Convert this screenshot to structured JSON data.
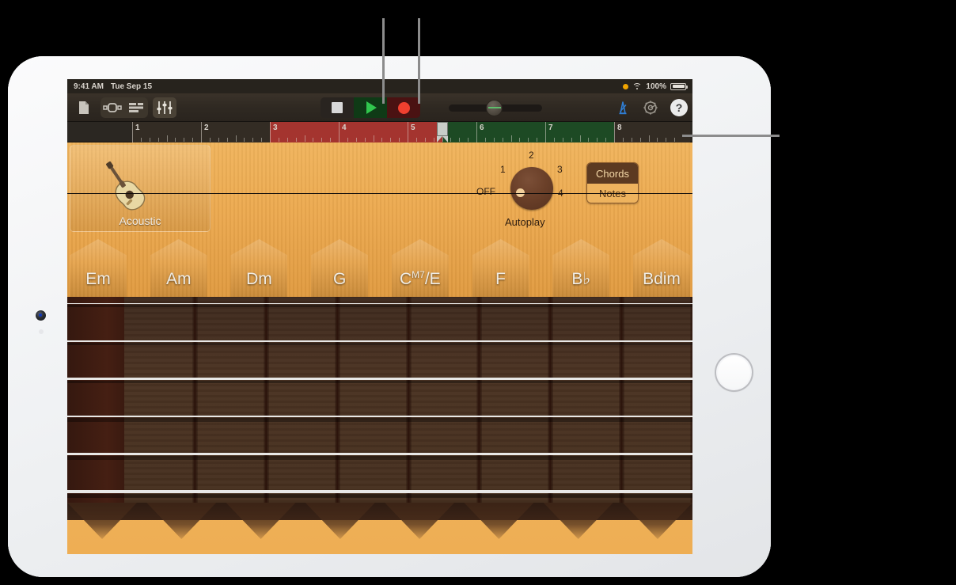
{
  "device": {
    "name": "ipad"
  },
  "status_bar": {
    "time": "9:41 AM",
    "date": "Tue Sep 15",
    "battery_percent": "100%",
    "recording_indicator": "orange-dot",
    "wifi_icon": "wifi-icon",
    "battery_icon": "battery-icon"
  },
  "toolbar": {
    "left_buttons": [
      {
        "name": "document-icon",
        "label": "Document"
      },
      {
        "name": "instrument-browser-icon",
        "label": "Browser"
      },
      {
        "name": "tracks-view-icon",
        "label": "Tracks"
      },
      {
        "name": "mixer-fx-icon",
        "label": "Mixer",
        "active": true
      }
    ],
    "transport": {
      "stop_label": "Stop",
      "play_label": "Play",
      "record_label": "Record"
    },
    "master_volume": {
      "name": "master-volume-slider",
      "value": 41
    },
    "metronome": {
      "name": "metronome-icon",
      "label": "Metronome",
      "color": "#2f7fd6",
      "on": true
    },
    "settings": {
      "name": "gear-icon",
      "label": "Settings"
    },
    "help": {
      "name": "help-button",
      "label": "?"
    }
  },
  "ruler": {
    "bars": [
      "1",
      "2",
      "3",
      "4",
      "5",
      "6",
      "7",
      "8"
    ],
    "playhead_bar": "5.5",
    "red_region": {
      "start_bar": "3",
      "end_bar": "5.5"
    },
    "green_region": {
      "start_bar": "5.5",
      "end_bar": "8"
    },
    "add_section_label": "+"
  },
  "instrument": {
    "card": {
      "name": "instrument-card",
      "label": "Acoustic",
      "icon": "acoustic-guitar-icon"
    },
    "autoplay": {
      "title": "Autoplay",
      "positions": [
        "OFF",
        "1",
        "2",
        "3",
        "4"
      ],
      "selected": "OFF"
    },
    "mode_toggle": {
      "chords_label": "Chords",
      "notes_label": "Notes",
      "selected": "Chords"
    },
    "chords": [
      {
        "root": "Em",
        "sup": "",
        "rest": ""
      },
      {
        "root": "Am",
        "sup": "",
        "rest": ""
      },
      {
        "root": "Dm",
        "sup": "",
        "rest": ""
      },
      {
        "root": "G",
        "sup": "",
        "rest": ""
      },
      {
        "root": "C",
        "sup": "M7",
        "rest": "/E"
      },
      {
        "root": "F",
        "sup": "",
        "rest": ""
      },
      {
        "root": "B♭",
        "sup": "",
        "rest": ""
      },
      {
        "root": "Bdim",
        "sup": "",
        "rest": ""
      }
    ],
    "fretboard": {
      "name": "guitar-fretboard",
      "strings": 6,
      "frets": 8
    },
    "soundhole": {
      "name": "soundhole"
    }
  },
  "callouts": {
    "play_pointer": "play-button-callout",
    "record_pointer": "record-button-callout",
    "section_pointer": "add-section-callout"
  },
  "colors": {
    "play_green": "#31c74e",
    "record_red": "#f0402f",
    "metronome_blue": "#2f7fd6",
    "wood": "#eca94f",
    "fretboard": "#46301f",
    "ruler_red": "#a4342f",
    "ruler_green": "#1d4a24"
  }
}
